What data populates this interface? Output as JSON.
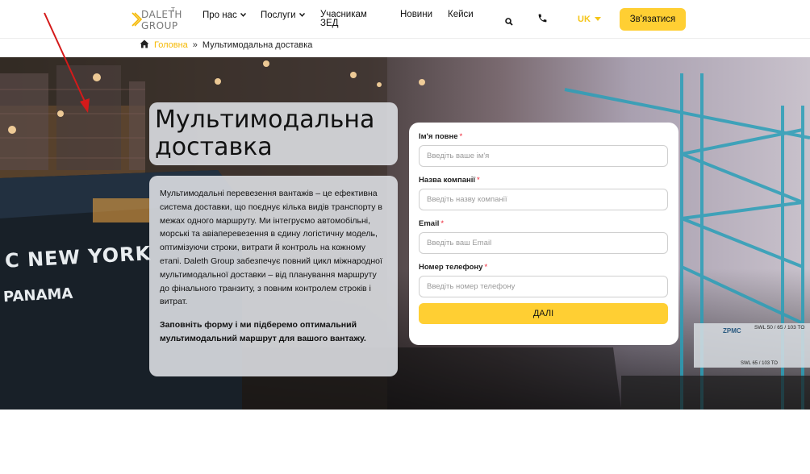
{
  "logo": {
    "line1": "DALETH",
    "line2": "GROUP",
    "tm": "T"
  },
  "nav": {
    "about": "Про нас",
    "services": "Послуги",
    "participants": "Учасникам ЗЕД",
    "news": "Новини",
    "cases": "Кейси"
  },
  "icons": {
    "search": "search-icon",
    "phone": "phone-icon",
    "chevron": "chevron-down-icon",
    "home": "home-icon"
  },
  "lang": "UK",
  "contact_button": "Зв'язатися",
  "breadcrumb": {
    "home": "Головна",
    "separator": "»",
    "current": "Мультимодальна доставка"
  },
  "hero": {
    "title": "Мультимодальна доставка",
    "description": "Мультимодальні перевезення вантажів – це ефективна система доставки, що поєднує кілька видів транспорту в межах одного маршруту. Ми інтегруємо автомобільні, морські та авіаперевезення в єдину логістичну модель, оптимізуючи строки, витрати й контроль на кожному етапі. Daleth Group забезпечує повний цикл міжнародної мультимодальної доставки – від планування маршруту до фінального транзиту, з повним контролем строків і витрат.",
    "cta": "Заповніть форму  і ми підберемо оптимальний мультимодальний маршрут для вашого вантажу.",
    "ship_text_1": "C NEW YORK",
    "ship_text_2": "PANAMA",
    "crane_text_1": "ZPMC",
    "crane_text_2": "SWL 50 / 65 / 103 TO",
    "crane_text_3": "SWL 65 / 103 TO"
  },
  "form": {
    "required_mark": "*",
    "full_name": {
      "label": "Ім'я повне",
      "placeholder": "Введіть ваше ім'я"
    },
    "company": {
      "label": "Назва компанії",
      "placeholder": "Введіть назву компанії"
    },
    "email": {
      "label": "Email",
      "placeholder": "Введіть ваш Email"
    },
    "phone": {
      "label": "Номер телефону",
      "placeholder": "Введіть номер телефону"
    },
    "submit": "ДАЛІ"
  },
  "colors": {
    "accent": "#ffcf33",
    "link": "#f5b800",
    "required": "#e22233"
  }
}
